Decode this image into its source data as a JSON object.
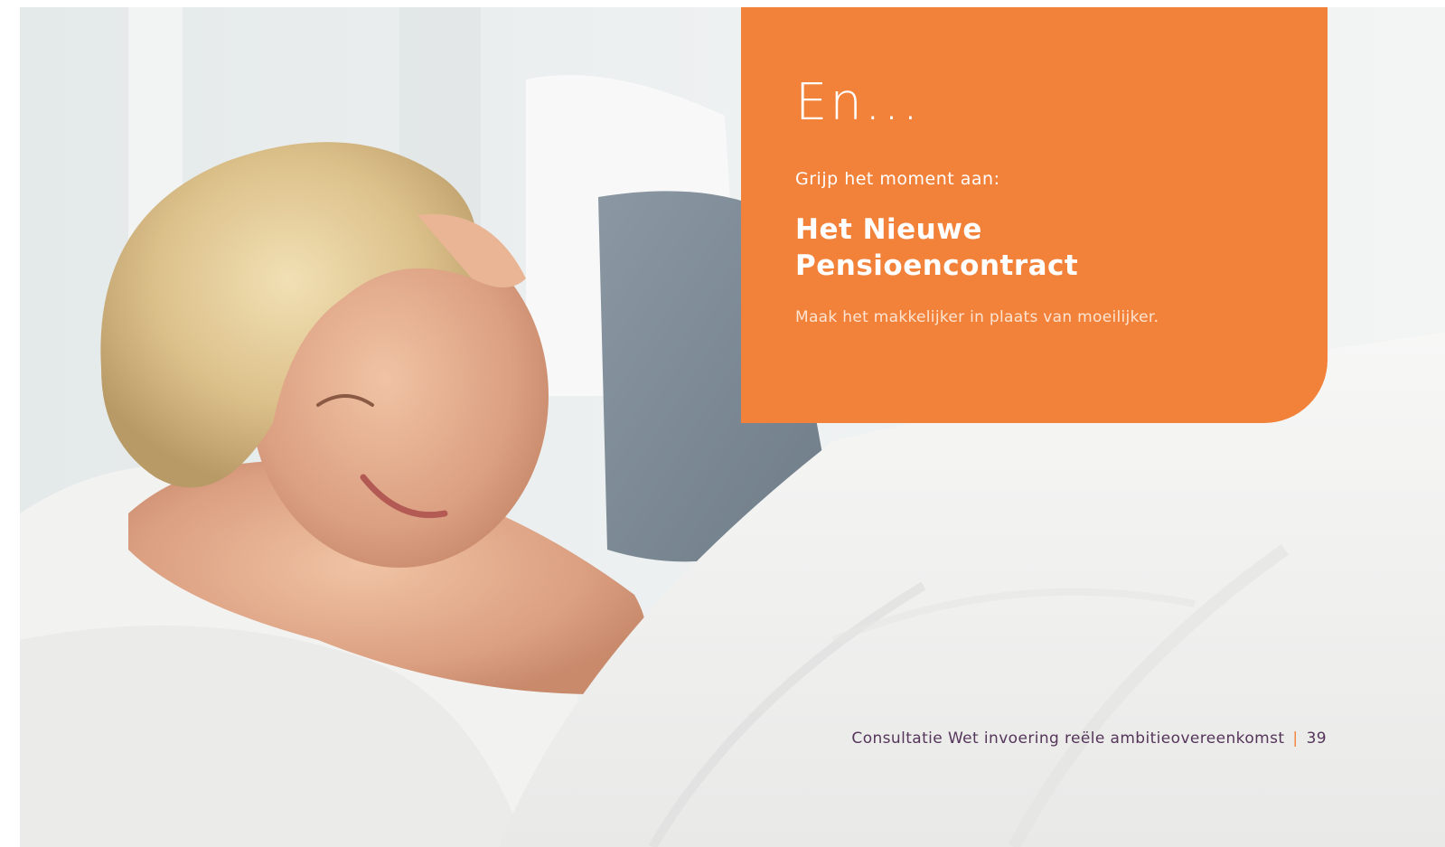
{
  "box": {
    "heading": "En...",
    "kicker": "Grijp het moment aan:",
    "title": "Het Nieuwe Pensioencontract",
    "tagline": "Maak het makkelijker in plaats van moeilijker."
  },
  "footer": {
    "document_title": "Consultatie Wet invoering reële ambitieovereenkomst",
    "separator": "|",
    "page_number": "39"
  },
  "colors": {
    "accent_orange": "#f2823a",
    "footer_text": "#55355a"
  }
}
